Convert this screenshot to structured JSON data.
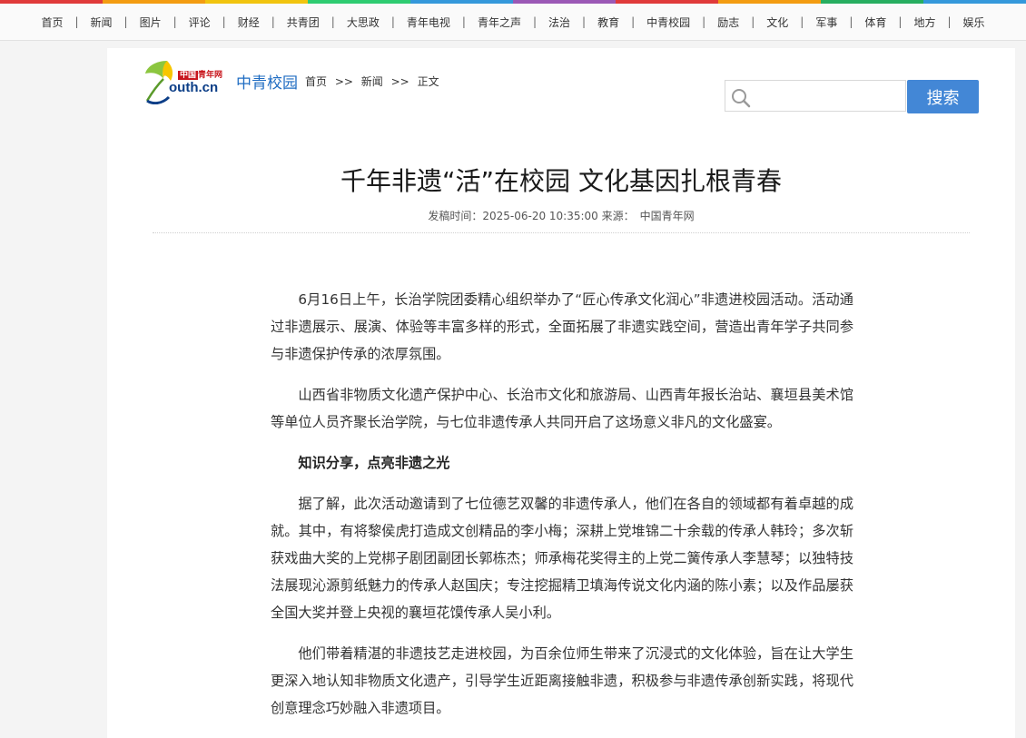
{
  "stripe_colors": [
    "#e03a3a",
    "#f39c12",
    "#f1c40f",
    "#2ecc71",
    "#3498db",
    "#9b59b6",
    "#e03a3a",
    "#f39c12",
    "#27ae60",
    "#3498db"
  ],
  "nav": {
    "separator": "|",
    "items": [
      "首页",
      "新闻",
      "图片",
      "评论",
      "财经",
      "共青团",
      "大思政",
      "青年电视",
      "青年之声",
      "法治",
      "教育",
      "中青校园",
      "励志",
      "文化",
      "军事",
      "体育",
      "地方",
      "娱乐"
    ]
  },
  "logo": {
    "badge_red": "中国",
    "badge_text": "青年网",
    "site_text": "outh.cn",
    "brand_color": "#0c3e87"
  },
  "header": {
    "section": "中青校园",
    "breadcrumb": {
      "home": "首页",
      "sep": ">>",
      "news": "新闻",
      "current": "正文"
    }
  },
  "search": {
    "placeholder": "",
    "button": "搜索",
    "button_color": "#4387d6"
  },
  "article": {
    "title": "千年非遗“活”在校园 文化基因扎根青春",
    "meta": {
      "time_label": "发稿时间：",
      "time": "2025-06-20 10:35:00",
      "source_label": "来源：",
      "source": "中国青年网"
    },
    "paragraphs": [
      "6月16日上午，长治学院团委精心组织举办了“匠心传承文化润心”非遗进校园活动。活动通过非遗展示、展演、体验等丰富多样的形式，全面拓展了非遗实践空间，营造出青年学子共同参与非遗保护传承的浓厚氛围。",
      "山西省非物质文化遗产保护中心、长治市文化和旅游局、山西青年报长治站、襄垣县美术馆等单位人员齐聚长治学院，与七位非遗传承人共同开启了这场意义非凡的文化盛宴。",
      "知识分享，点亮非遗之光",
      "据了解，此次活动邀请到了七位德艺双馨的非遗传承人，他们在各自的领域都有着卓越的成就。其中，有将黎侯虎打造成文创精品的李小梅；深耕上党堆锦二十余载的传承人韩玲；多次斩获戏曲大奖的上党梆子剧团副团长郭栋杰；师承梅花奖得主的上党二簧传承人李慧琴；以独特技法展现沁源剪纸魅力的传承人赵国庆；专注挖掘精卫填海传说文化内涵的陈小素；以及作品屡获全国大奖并登上央视的襄垣花馍传承人吴小利。",
      "他们带着精湛的非遗技艺走进校园，为百余位师生带来了沉浸式的文化体验，旨在让大学生更深入地认知非物质文化遗产，引导学生近距离接触非遗，积极参与非遗传承创新实践，将现代创意理念巧妙融入非遗项目。"
    ]
  }
}
